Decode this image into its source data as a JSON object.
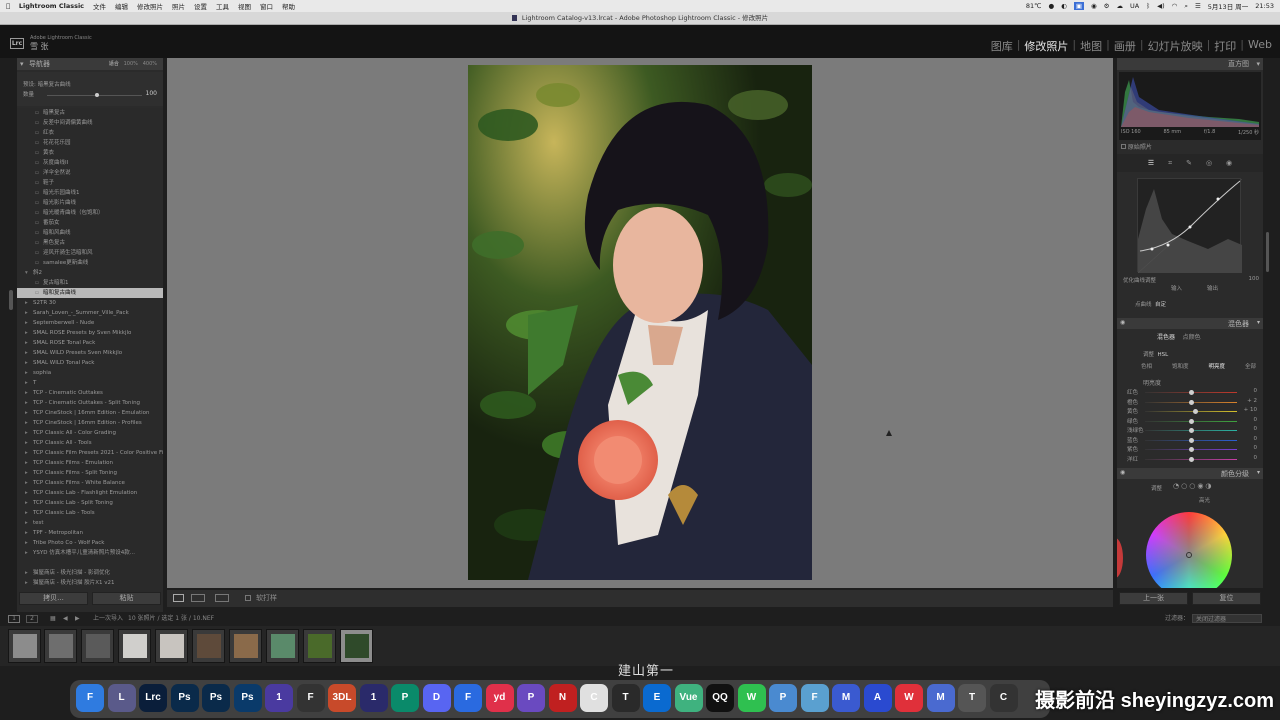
{
  "menubar": {
    "app": "Lightroom Classic",
    "items": [
      "文件",
      "编辑",
      "修改照片",
      "照片",
      "设置",
      "工具",
      "视图",
      "窗口",
      "帮助"
    ],
    "status_items": [
      "81℃",
      "UA",
      "5月13日 周一",
      "21:53"
    ]
  },
  "window": {
    "title": "Lightroom Catalog-v13.lrcat - Adobe Photoshop Lightroom Classic - 修改照片"
  },
  "app_header": {
    "logo": "Lrc",
    "app_name": "Adobe Lightroom Classic",
    "user": "雪 张"
  },
  "modules": [
    "图库",
    "修改照片",
    "地图",
    "画册",
    "幻灯片放映",
    "打印",
    "Web"
  ],
  "active_module": "修改照片",
  "left": {
    "navigator": {
      "title": "导航器",
      "fit": "适合",
      "z1": "100%",
      "z2": "400%"
    },
    "preset_info": {
      "label": "预设: 暗黑复古曲线",
      "amount_label": "数量",
      "amount_value": "100",
      "amount_pct": 100
    },
    "presets": [
      {
        "t": "暗黑复古",
        "lvl": 1
      },
      {
        "t": "反差中间调偏黄曲线",
        "lvl": 1
      },
      {
        "t": "红衣",
        "lvl": 1
      },
      {
        "t": "花花花乐园",
        "lvl": 1
      },
      {
        "t": "黄衣",
        "lvl": 1
      },
      {
        "t": "灰度曲线II",
        "lvl": 1
      },
      {
        "t": "洋伞全然说",
        "lvl": 1
      },
      {
        "t": "鞋子",
        "lvl": 1
      },
      {
        "t": "暗光乐园曲线1",
        "lvl": 1
      },
      {
        "t": "暗光影片曲线",
        "lvl": 1
      },
      {
        "t": "暗光暖青曲线（包饱和）",
        "lvl": 1
      },
      {
        "t": "番茄女",
        "lvl": 1
      },
      {
        "t": "暗和风曲线",
        "lvl": 1
      },
      {
        "t": "黑色复古",
        "lvl": 1
      },
      {
        "t": "迎风开骑生活暗和风",
        "lvl": 1
      },
      {
        "t": "samalee更新曲线",
        "lvl": 1
      },
      {
        "t": "斜2",
        "lvl": 0,
        "open": true
      },
      {
        "t": "复古暗和1",
        "lvl": 1
      },
      {
        "t": "暗和复古曲线",
        "lvl": 1,
        "sel": true
      },
      {
        "t": "S2TR 30",
        "lvl": 0
      },
      {
        "t": "Sarah_Loven_-_Summer_Ville_Pack",
        "lvl": 0
      },
      {
        "t": "Septemberwell - Nude",
        "lvl": 0
      },
      {
        "t": "SMAL ROSE Presets by Sven Mikkjlo",
        "lvl": 0
      },
      {
        "t": "SMAL ROSE Tonal Pack",
        "lvl": 0
      },
      {
        "t": "SMAL WILD Presets Sven Mikkjlo",
        "lvl": 0
      },
      {
        "t": "SMAL WILD Tonal Pack",
        "lvl": 0
      },
      {
        "t": "sophia",
        "lvl": 0
      },
      {
        "t": "T",
        "lvl": 0
      },
      {
        "t": "TCP - Cinematic Outtakes",
        "lvl": 0
      },
      {
        "t": "TCP - Cinematic Outtakes - Split Toning",
        "lvl": 0
      },
      {
        "t": "TCP CineStock | 16mm Edition - Emulation",
        "lvl": 0
      },
      {
        "t": "TCP CineStock | 16mm Edition - Profiles",
        "lvl": 0
      },
      {
        "t": "TCP Classic All - Color Grading",
        "lvl": 0
      },
      {
        "t": "TCP Classic All - Tools",
        "lvl": 0
      },
      {
        "t": "TCP Classic Film Presets 2021 - Color Positive Fil",
        "lvl": 0
      },
      {
        "t": "TCP Classic Films - Emulation",
        "lvl": 0
      },
      {
        "t": "TCP Classic Films - Split Toning",
        "lvl": 0
      },
      {
        "t": "TCP Classic Films - White Balance",
        "lvl": 0
      },
      {
        "t": "TCP Classic Lab - Flashlight Emulation",
        "lvl": 0
      },
      {
        "t": "TCP Classic Lab - Split Toning",
        "lvl": 0
      },
      {
        "t": "TCP Classic Lab - Tools",
        "lvl": 0
      },
      {
        "t": "test",
        "lvl": 0
      },
      {
        "t": "TPF - Metropolitan",
        "lvl": 0
      },
      {
        "t": "Tribe Photo Co - Wolf Pack",
        "lvl": 0
      },
      {
        "t": "YSYD 仿真木槽平儿童清新照片预设4款...",
        "lvl": 0
      },
      {
        "t": "",
        "lvl": -1
      },
      {
        "t": "猫屋商店 - 极光扫描 - 影调优化",
        "lvl": 0
      },
      {
        "t": "猫屋商店 - 极光扫描 胶片X1 v21",
        "lvl": 0
      }
    ],
    "buttons": {
      "copy": "拷贝...",
      "paste": "粘贴"
    }
  },
  "toolbar": {
    "softproof": "软打样"
  },
  "right": {
    "histogram_title": "直方图",
    "histogram_info": [
      "ISO 160",
      "85 mm",
      "f/1.8",
      "1/250 秒"
    ],
    "original_photo": "原始照片",
    "curve_region": "区域",
    "curve_adjust": "调整",
    "curve_refine": "优化曲线调整",
    "curve_value": "100",
    "curve_input": "输入",
    "curve_output": "输出",
    "channel_label": "点曲线",
    "channel_value": "自定",
    "mixer_title": "混色器",
    "mixer_tabs": [
      "混色器",
      "点颜色"
    ],
    "adjust_label": "调整",
    "adjust_value": "HSL",
    "hsl_tabs": [
      "色相",
      "饱和度",
      "明亮度",
      "全部"
    ],
    "hsl_active": "明亮度",
    "luminance_label": "明亮度",
    "hsl_sliders": [
      {
        "name": "红色",
        "value": "0",
        "pos": 0.5,
        "color": "#c0392b"
      },
      {
        "name": "橙色",
        "value": "+ 2",
        "pos": 0.51,
        "color": "#d9822b"
      },
      {
        "name": "黄色",
        "value": "+ 10",
        "pos": 0.55,
        "color": "#d4c12b"
      },
      {
        "name": "绿色",
        "value": "0",
        "pos": 0.5,
        "color": "#3fa33f"
      },
      {
        "name": "浅绿色",
        "value": "0",
        "pos": 0.5,
        "color": "#2bb3a3"
      },
      {
        "name": "蓝色",
        "value": "0",
        "pos": 0.5,
        "color": "#2b5fd4"
      },
      {
        "name": "紫色",
        "value": "0",
        "pos": 0.5,
        "color": "#7a3fd4"
      },
      {
        "name": "洋红",
        "value": "0",
        "pos": 0.5,
        "color": "#c83fa8"
      }
    ],
    "grading_title": "颜色分级",
    "grading_adjust": "调整",
    "grading_highlight": "高光",
    "buttons": {
      "previous": "上一张",
      "reset": "复位"
    }
  },
  "filmstrip": {
    "source": "上一次导入",
    "info": "10 张照片 / 选定 1 张 / 10.NEF",
    "filter_label": "过滤器：",
    "filter_value": "关闭过滤器",
    "page1": "1",
    "page2": "2",
    "selected_index": 9,
    "thumbs": 10
  },
  "subtitle": "建山第一",
  "watermark": "摄影前沿 sheyingzyz.com",
  "dock": [
    "Finder",
    "Launchpad",
    "Lrc",
    "Ps",
    "Ps",
    "Ps",
    "1",
    "Final Cut",
    "3DL",
    "1",
    "Proxy",
    "Discord",
    "Feishu",
    "yd",
    "Paint",
    "NetEase",
    "Chrome",
    "Terminal",
    "Edge",
    "Vue",
    "QQ",
    "WeChat",
    "Pixel",
    "Finder2",
    "Move",
    "Arrow",
    "Weibo",
    "Mail",
    "Tools",
    "Clock"
  ],
  "colors": {
    "accent": "#b9b9b9",
    "panel": "#2b2b2b",
    "center_bg": "#7b7b7b"
  }
}
